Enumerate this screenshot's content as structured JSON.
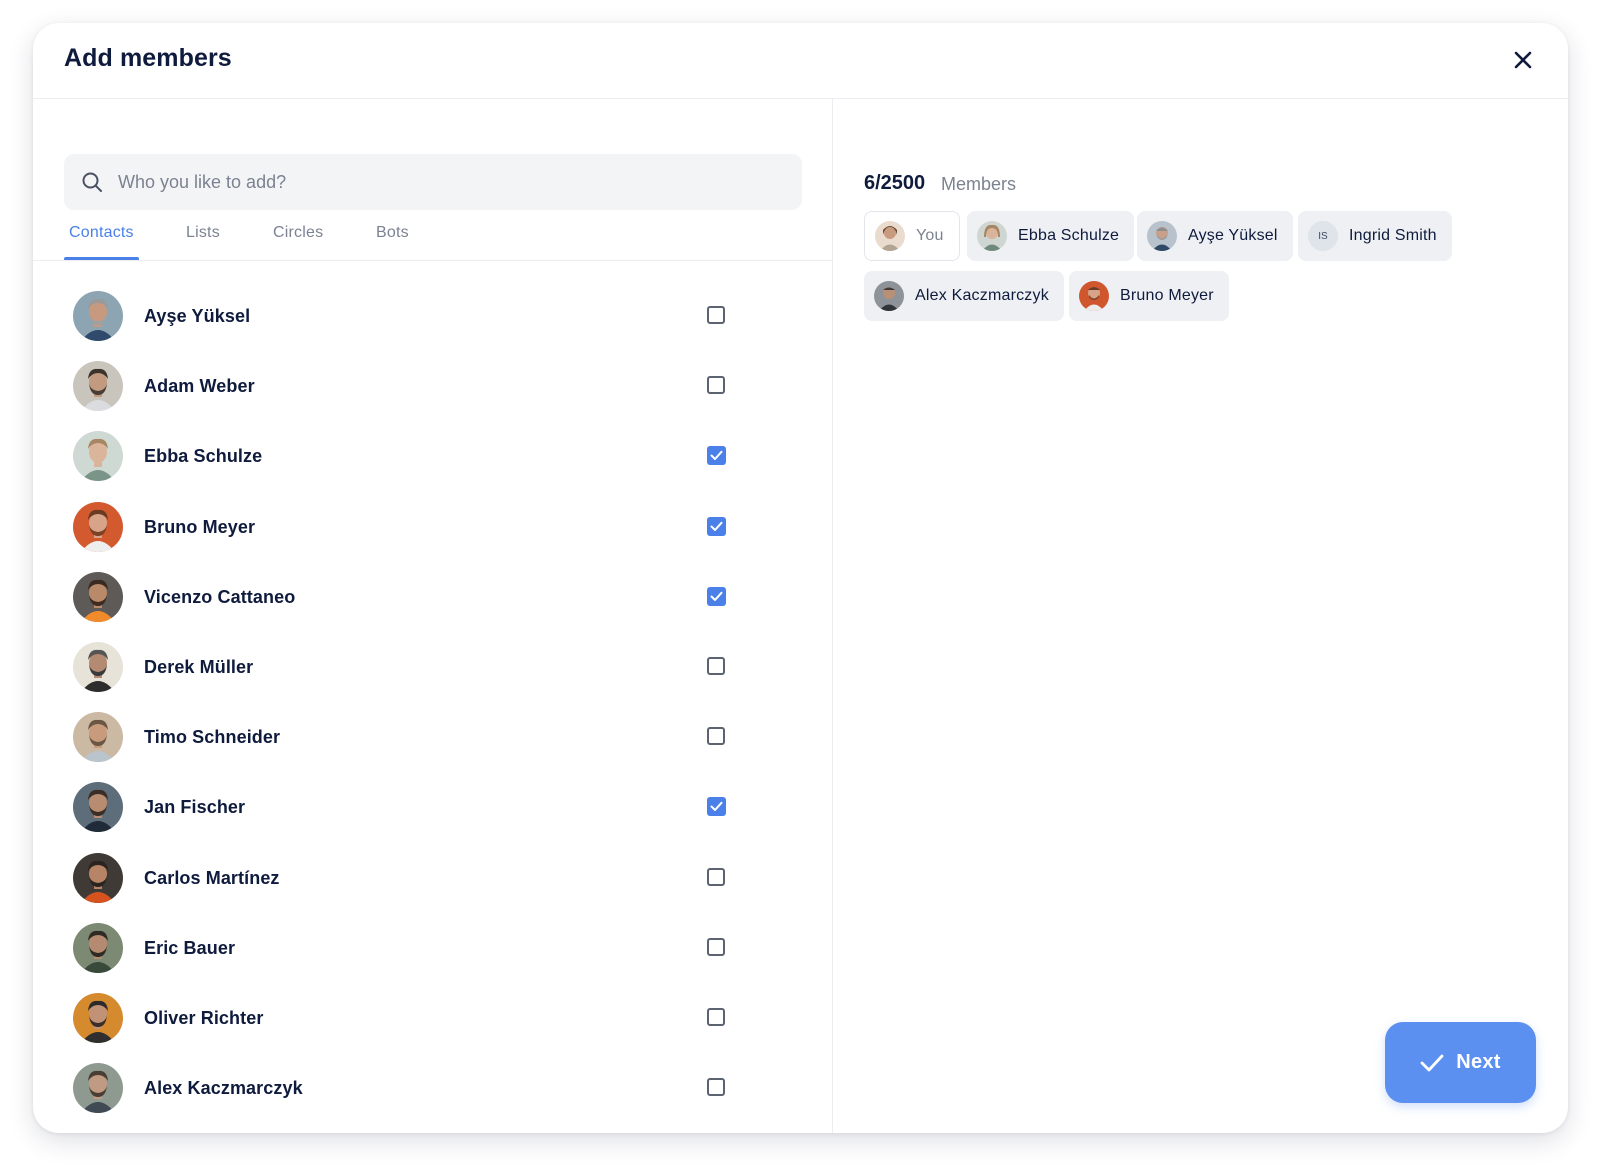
{
  "dialog": {
    "title": "Add members",
    "close_icon": "close-icon"
  },
  "search": {
    "placeholder": "Who you like to add?",
    "value": "",
    "icon": "search-icon"
  },
  "tabs": [
    {
      "label": "Contacts",
      "active": true
    },
    {
      "label": "Lists",
      "active": false
    },
    {
      "label": "Circles",
      "active": false
    },
    {
      "label": "Bots",
      "active": false
    }
  ],
  "contacts": [
    {
      "name": "Ayşe Yüksel",
      "checked": false,
      "avatar": "avatar-photo"
    },
    {
      "name": "Adam Weber",
      "checked": false,
      "avatar": "avatar-photo"
    },
    {
      "name": "Ebba Schulze",
      "checked": true,
      "avatar": "avatar-photo"
    },
    {
      "name": "Bruno Meyer",
      "checked": true,
      "avatar": "avatar-photo"
    },
    {
      "name": "Vicenzo Cattaneo",
      "checked": true,
      "avatar": "avatar-photo"
    },
    {
      "name": "Derek Müller",
      "checked": false,
      "avatar": "avatar-photo"
    },
    {
      "name": "Timo Schneider",
      "checked": false,
      "avatar": "avatar-photo"
    },
    {
      "name": "Jan Fischer",
      "checked": true,
      "avatar": "avatar-photo"
    },
    {
      "name": "Carlos Martínez",
      "checked": false,
      "avatar": "avatar-photo"
    },
    {
      "name": "Eric Bauer",
      "checked": false,
      "avatar": "avatar-photo"
    },
    {
      "name": "Oliver Richter",
      "checked": false,
      "avatar": "avatar-photo"
    },
    {
      "name": "Alex Kaczmarczyk",
      "checked": false,
      "avatar": "avatar-photo"
    }
  ],
  "members": {
    "count": "6/2500",
    "label": "Members",
    "chips": [
      {
        "label": "You",
        "avatar": "avatar-photo"
      },
      {
        "label": "Ebba Schulze",
        "avatar": "avatar-photo"
      },
      {
        "label": "Ayşe Yüksel",
        "avatar": "avatar-photo"
      },
      {
        "label": "Ingrid Smith",
        "initials": "IS"
      },
      {
        "label": "Alex Kaczmarczyk",
        "avatar": "avatar-photo"
      },
      {
        "label": "Bruno Meyer",
        "avatar": "avatar-photo"
      }
    ]
  },
  "next_button": {
    "label": "Next",
    "icon": "check-icon"
  },
  "colors": {
    "accent": "#4a80e8",
    "next_button": "#5b8ff0",
    "text_primary": "#0f1b3d",
    "text_secondary": "#7b8291",
    "chip_bg": "#eef0f3",
    "search_bg": "#f3f4f6"
  }
}
